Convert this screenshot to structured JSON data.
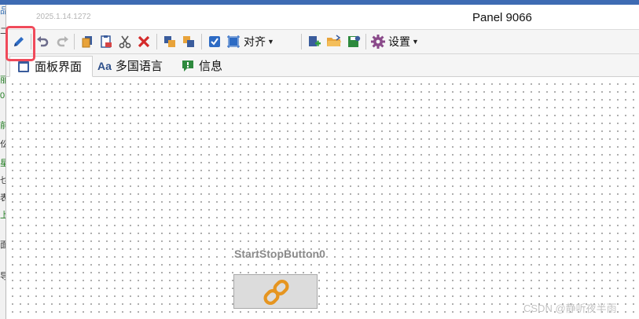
{
  "window": {
    "version": "2025.1.14.1272",
    "panel_title": "Panel 9066"
  },
  "toolbar": {
    "items": [
      {
        "name": "edit",
        "icon": "pencil-icon"
      },
      {
        "name": "undo",
        "icon": "undo-icon"
      },
      {
        "name": "redo",
        "icon": "redo-icon"
      },
      {
        "name": "copy",
        "icon": "copy-icon"
      },
      {
        "name": "paste",
        "icon": "paste-icon"
      },
      {
        "name": "cut",
        "icon": "scissors-icon"
      },
      {
        "name": "delete",
        "icon": "delete-x-icon"
      },
      {
        "name": "bring-front",
        "icon": "bring-front-icon"
      },
      {
        "name": "send-back",
        "icon": "send-back-icon"
      },
      {
        "name": "select-all",
        "icon": "checkbox-icon"
      },
      {
        "name": "align",
        "icon": "align-icon"
      },
      {
        "name": "add",
        "icon": "add-file-icon"
      },
      {
        "name": "open",
        "icon": "folder-icon"
      },
      {
        "name": "save",
        "icon": "save-icon"
      },
      {
        "name": "settings",
        "icon": "gear-icon"
      }
    ],
    "align_label": "对齐",
    "settings_label": "设置",
    "highlight_color": "#f04a5a"
  },
  "tabs": [
    {
      "label": "面板界面",
      "icon": "panel-icon",
      "active": true
    },
    {
      "label": "多国语言",
      "icon": "font-aa-icon",
      "active": false
    },
    {
      "label": "信息",
      "icon": "message-icon",
      "active": false
    }
  ],
  "canvas": {
    "control": {
      "label": "StartStopButton0",
      "icon": "link-icon",
      "icon_color": "#e69520"
    }
  },
  "watermark": "CSDN @静听夜半雨",
  "left_strip_chars": [
    "品",
    "二",
    "丽",
    "0",
    "前",
    "仫",
    "星",
    "乜",
    "表",
    "上",
    "面",
    "导"
  ]
}
